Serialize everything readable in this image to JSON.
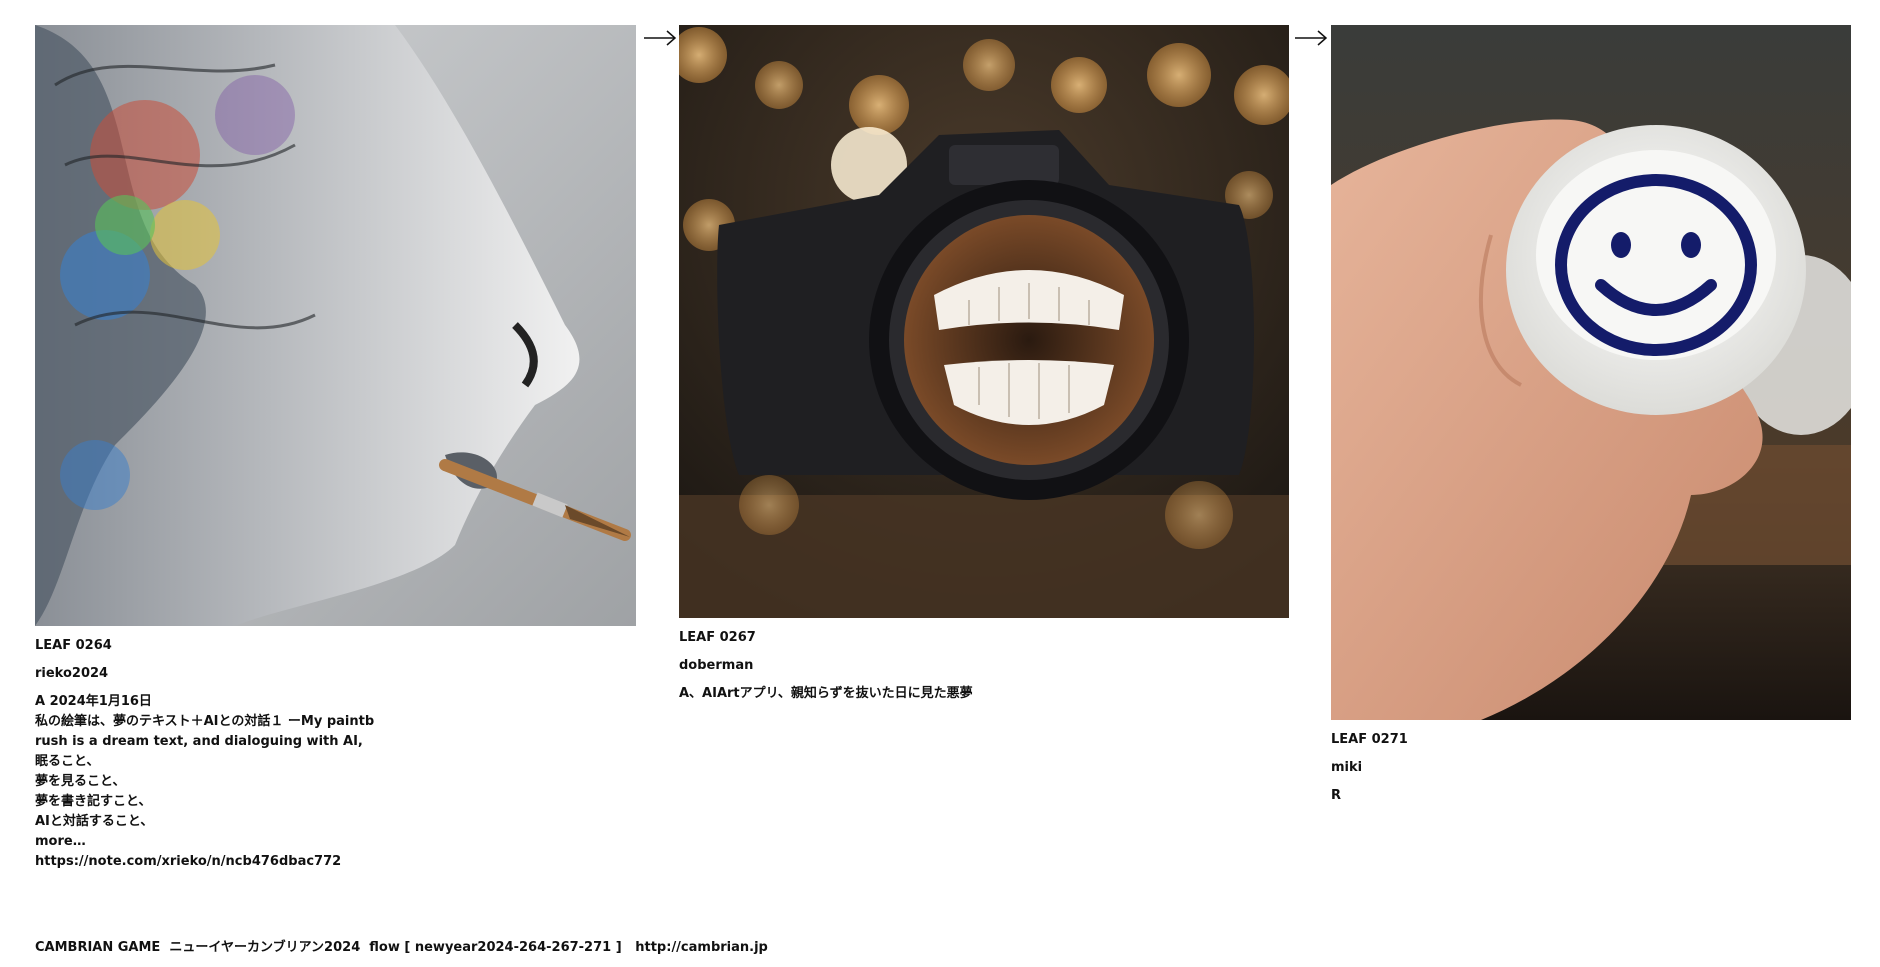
{
  "leaves": [
    {
      "id": "LEAF 0264",
      "author": "rieko2024",
      "description": [
        "A 2024年1月16日",
        "私の絵筆は、夢のテキスト＋AIとの対話１ ーMy paintb",
        "rush is a dream text, and dialoguing with AI,",
        "眠ること、",
        "夢を見ること、",
        "夢を書き記すこと、",
        "AIと対話すること、",
        "more…",
        "https://note.com/xrieko/n/ncb476dbac772"
      ],
      "image_subject": "painted-face-with-paintbrush-image"
    },
    {
      "id": "LEAF 0267",
      "author": "doberman",
      "description": [
        "A、AIArtアプリ、親知らずを抜いた日に見た悪夢"
      ],
      "image_subject": "camera-with-teeth-image"
    },
    {
      "id": "LEAF 0271",
      "author": "miki",
      "description": [
        "R"
      ],
      "image_subject": "smiley-sake-cup-image"
    }
  ],
  "arrow_glyph": "→",
  "footer": {
    "text": "CAMBRIAN GAME  ニューイヤーカンブリアン2024  flow [ newyear2024-264-267-271 ]   ",
    "link": "http://cambrian.jp"
  }
}
